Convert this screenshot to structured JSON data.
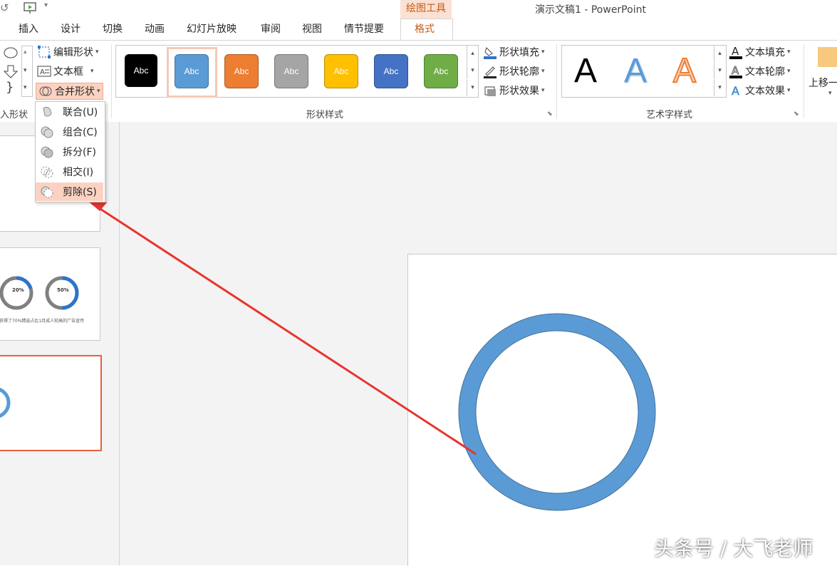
{
  "window": {
    "app_title": "演示文稿1 - PowerPoint",
    "contextual_tab_group": "绘图工具"
  },
  "tabs": [
    "插入",
    "设计",
    "切换",
    "动画",
    "幻灯片放映",
    "审阅",
    "视图",
    "情节提要",
    "格式"
  ],
  "ribbon": {
    "insert_shapes": {
      "label": "入形状",
      "edit_shape": "编辑形状",
      "text_box": "文本框",
      "merge_shapes": "合并形状"
    },
    "shape_styles": {
      "label": "形状样式",
      "swatches": [
        {
          "text": "Abc",
          "color": "#000000"
        },
        {
          "text": "Abc",
          "color": "#5b9bd5"
        },
        {
          "text": "Abc",
          "color": "#ed7d31"
        },
        {
          "text": "Abc",
          "color": "#a5a5a5"
        },
        {
          "text": "Abc",
          "color": "#ffc000"
        },
        {
          "text": "Abc",
          "color": "#4472c4"
        },
        {
          "text": "Abc",
          "color": "#70ad47"
        }
      ],
      "selected_index": 1,
      "shape_fill": "形状填充",
      "shape_outline": "形状轮廓",
      "shape_effects": "形状效果"
    },
    "wordart_styles": {
      "label": "艺术字样式",
      "samples": [
        {
          "text": "A",
          "color": "#000000"
        },
        {
          "text": "A",
          "color": "#5b9bd5"
        },
        {
          "text": "A",
          "color": "#ed7d31"
        }
      ],
      "text_fill": "文本填充",
      "text_outline": "文本轮廓",
      "text_effects": "文本效果"
    },
    "arrange": {
      "bring_forward": "上移一"
    }
  },
  "merge_menu": {
    "items": [
      {
        "label": "联合(U)",
        "key": "U"
      },
      {
        "label": "组合(C)",
        "key": "C"
      },
      {
        "label": "拆分(F)",
        "key": "F"
      },
      {
        "label": "相交(I)",
        "key": "I"
      },
      {
        "label": "剪除(S)",
        "key": "S"
      }
    ],
    "highlighted": "剪除(S)"
  },
  "thumbnails": {
    "slide2": {
      "rings": [
        {
          "percent": "20%",
          "fill": 0.2
        },
        {
          "percent": "50%",
          "fill": 0.5
        }
      ],
      "caption": "获得了70%精选占比1月成人较高的广告宣传"
    }
  },
  "slide": {
    "ring_color": "#5b9bd5"
  },
  "watermark": "头条号 / 大飞老师",
  "colors": {
    "accent": "#c55a11",
    "highlight": "#fbd2c1",
    "annotation_arrow": "#e8342e"
  }
}
